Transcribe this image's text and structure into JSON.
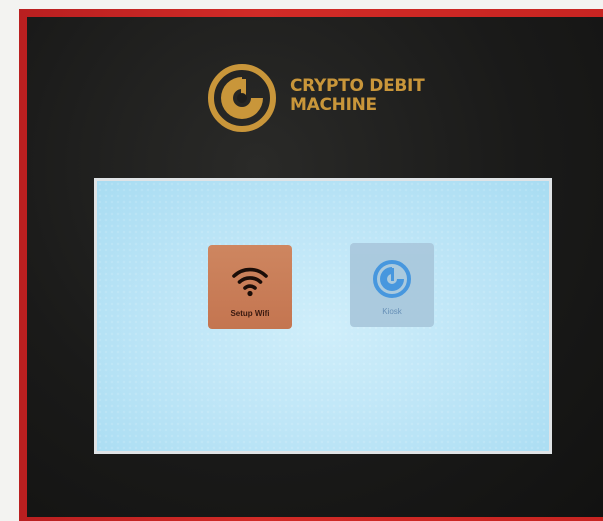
{
  "brand": {
    "line1": "CRYPTO DEBIT",
    "line2": "MACHINE",
    "logo_icon": "crypto-debit-logo-icon",
    "color": "#c9963a"
  },
  "apps": [
    {
      "label": "Setup Wifi",
      "icon": "wifi-icon",
      "tile_color": "#c97a54"
    },
    {
      "label": "Kiosk",
      "icon": "kiosk-logo-icon",
      "tile_color": "#a8c7dc",
      "icon_color": "#3a8fdc"
    }
  ],
  "colors": {
    "casing": "#c72421",
    "bezel": "#1a1a19",
    "screen_background": "#bfe6f7"
  }
}
